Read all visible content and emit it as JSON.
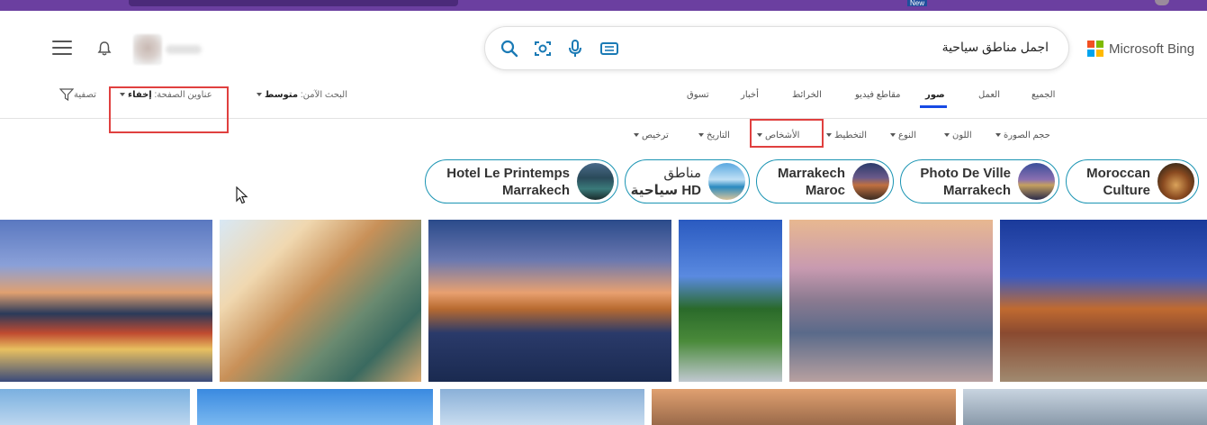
{
  "topbar": {
    "new_badge": "New"
  },
  "brand": {
    "name": "Microsoft Bing"
  },
  "search": {
    "query": "اجمل مناطق سياحية"
  },
  "nav": {
    "tabs": [
      {
        "label": "الجميع"
      },
      {
        "label": "العمل"
      },
      {
        "label": "صور"
      },
      {
        "label": "مقاطع فيديو"
      },
      {
        "label": "الخرائط"
      },
      {
        "label": "أخبار"
      },
      {
        "label": "تسوق"
      }
    ],
    "active_tab": "صور"
  },
  "options": {
    "safesearch_label": "البحث الآمن:",
    "safesearch_value": "متوسط",
    "page_titles_label": "عناوين الصفحة:",
    "page_titles_value": "إخفاء",
    "filter_label": "تصفية"
  },
  "filters": [
    {
      "label": "حجم الصورة"
    },
    {
      "label": "اللون"
    },
    {
      "label": "النوع"
    },
    {
      "label": "التخطيط"
    },
    {
      "label": "الأشخاص"
    },
    {
      "label": "التاريخ"
    },
    {
      "label": "ترخيص"
    }
  ],
  "related": [
    {
      "line1": "Moroccan",
      "line2": "Culture"
    },
    {
      "line1": "Photo De Ville",
      "line2": "Marrakech"
    },
    {
      "line1": "Marrakech",
      "line2": "Maroc"
    },
    {
      "line1": "مناطق",
      "line2": "سياحية HD"
    },
    {
      "line1": "Hotel Le Printemps",
      "line2": "Marrakech"
    }
  ],
  "colors": {
    "accent": "#174ae4",
    "chip_border": "#1a94b3",
    "highlight": "#e0403f",
    "topbar": "#6b3fa0"
  }
}
